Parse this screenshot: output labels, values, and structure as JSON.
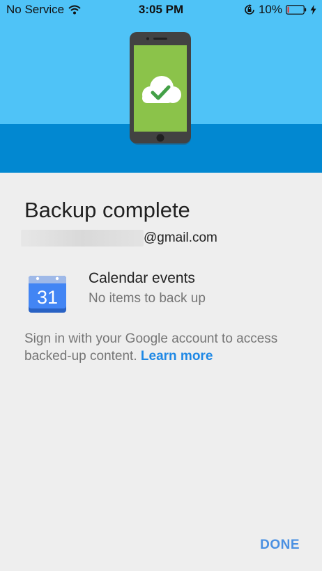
{
  "status_bar": {
    "carrier": "No Service",
    "time": "3:05 PM",
    "battery_percent": "10%",
    "battery_level": 0.1,
    "icons": [
      "wifi-icon",
      "lock-rotation-icon",
      "battery-icon",
      "bolt-icon"
    ]
  },
  "colors": {
    "header_light": "#4fc3f7",
    "header_dark": "#0288d1",
    "screen_green": "#8bc34a",
    "accent_blue": "#1e88e5",
    "calendar_blue": "#4285f4"
  },
  "header": {
    "illustration_icon": "phone-cloud-check-icon"
  },
  "content": {
    "title": "Backup complete",
    "email_domain": "@gmail.com",
    "item": {
      "icon": "calendar-icon",
      "icon_number": "31",
      "title": "Calendar events",
      "subtitle": "No items to back up"
    },
    "info_text": "Sign in with your Google account to access backed-up content.",
    "learn_more": "Learn more",
    "done_label": "DONE"
  }
}
